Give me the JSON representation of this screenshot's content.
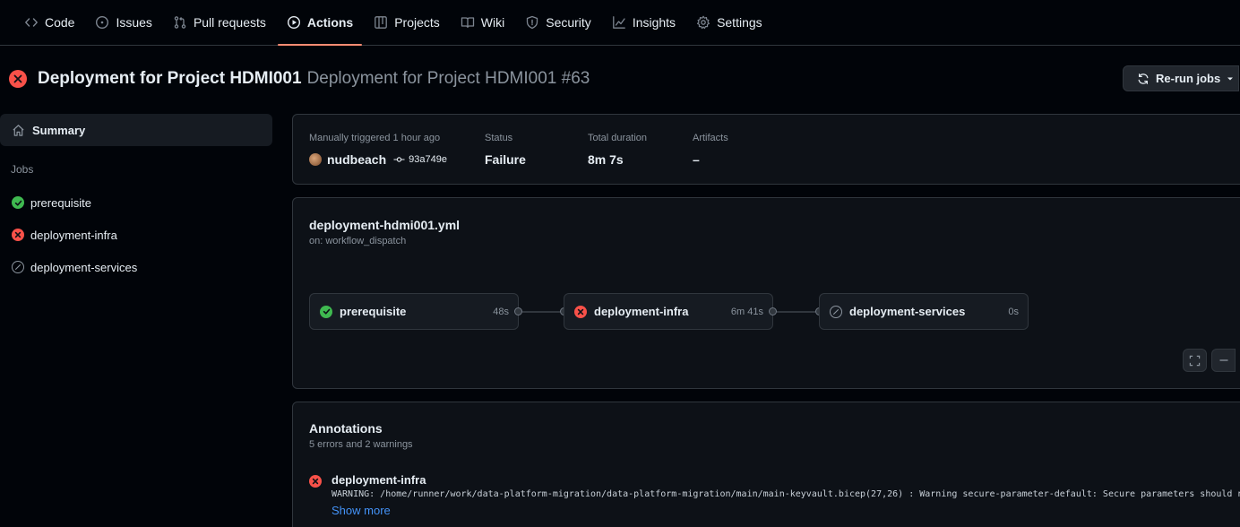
{
  "nav": {
    "tabs": [
      {
        "label": "Code",
        "icon": "code-icon"
      },
      {
        "label": "Issues",
        "icon": "issue-opened-icon"
      },
      {
        "label": "Pull requests",
        "icon": "git-pull-request-icon"
      },
      {
        "label": "Actions",
        "icon": "play-icon",
        "active": true
      },
      {
        "label": "Projects",
        "icon": "table-icon"
      },
      {
        "label": "Wiki",
        "icon": "book-icon"
      },
      {
        "label": "Security",
        "icon": "shield-icon"
      },
      {
        "label": "Insights",
        "icon": "graph-icon"
      },
      {
        "label": "Settings",
        "icon": "gear-icon"
      }
    ]
  },
  "header": {
    "workflow_title": "Deployment for Project HDMI001",
    "run_title": "Deployment for Project HDMI001 #63",
    "status": "failure",
    "rerun_label": "Re-run jobs"
  },
  "sidebar": {
    "summary_label": "Summary",
    "jobs_heading": "Jobs",
    "jobs": [
      {
        "label": "prerequisite",
        "status": "success"
      },
      {
        "label": "deployment-infra",
        "status": "failure"
      },
      {
        "label": "deployment-services",
        "status": "skipped"
      }
    ]
  },
  "summary": {
    "trigger_label": "Manually triggered 1 hour ago",
    "actor": "nudbeach",
    "commit": "93a749e",
    "status_label": "Status",
    "status_value": "Failure",
    "duration_label": "Total duration",
    "duration_value": "8m 7s",
    "artifacts_label": "Artifacts",
    "artifacts_value": "–"
  },
  "graph": {
    "file": "deployment-hdmi001.yml",
    "trigger": "on: workflow_dispatch",
    "jobs": [
      {
        "name": "prerequisite",
        "duration": "48s",
        "status": "success"
      },
      {
        "name": "deployment-infra",
        "duration": "6m 41s",
        "status": "failure"
      },
      {
        "name": "deployment-services",
        "duration": "0s",
        "status": "skipped"
      }
    ]
  },
  "annotations": {
    "title": "Annotations",
    "subtitle": "5 errors and 2 warnings",
    "items": [
      {
        "job": "deployment-infra",
        "message": "WARNING: /home/runner/work/data-platform-migration/data-platform-migration/main/main-keyvault.bicep(27,26) : Warning secure-parameter-default: Secure parameters should not",
        "more_label": "Show more"
      }
    ]
  },
  "colors": {
    "background": "#010409",
    "card": "#0d1117",
    "border": "#30363d",
    "success": "#3fb950",
    "failure": "#f85149",
    "link": "#4493f8",
    "active_tab_underline": "#fd8c73"
  }
}
